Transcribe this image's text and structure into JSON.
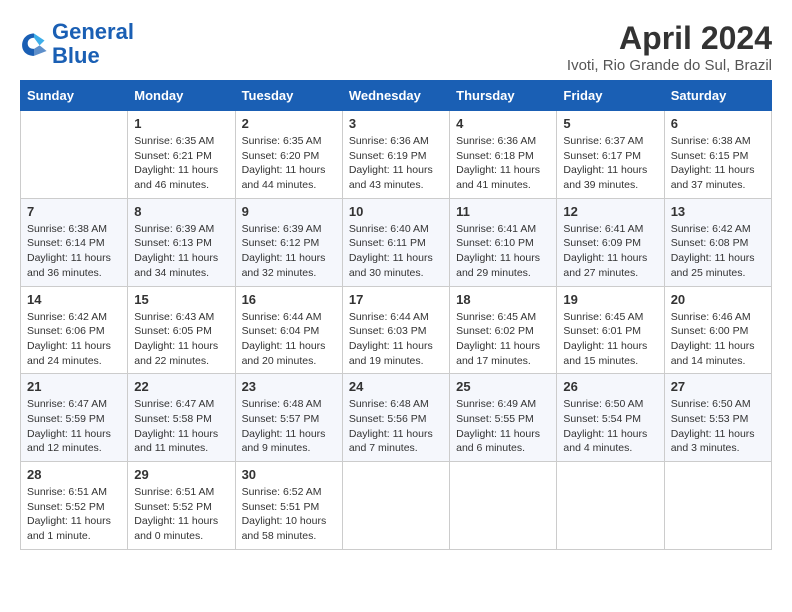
{
  "header": {
    "logo_line1": "General",
    "logo_line2": "Blue",
    "month_title": "April 2024",
    "location": "Ivoti, Rio Grande do Sul, Brazil"
  },
  "days_of_week": [
    "Sunday",
    "Monday",
    "Tuesday",
    "Wednesday",
    "Thursday",
    "Friday",
    "Saturday"
  ],
  "weeks": [
    [
      {
        "day": "",
        "info": ""
      },
      {
        "day": "1",
        "info": "Sunrise: 6:35 AM\nSunset: 6:21 PM\nDaylight: 11 hours\nand 46 minutes."
      },
      {
        "day": "2",
        "info": "Sunrise: 6:35 AM\nSunset: 6:20 PM\nDaylight: 11 hours\nand 44 minutes."
      },
      {
        "day": "3",
        "info": "Sunrise: 6:36 AM\nSunset: 6:19 PM\nDaylight: 11 hours\nand 43 minutes."
      },
      {
        "day": "4",
        "info": "Sunrise: 6:36 AM\nSunset: 6:18 PM\nDaylight: 11 hours\nand 41 minutes."
      },
      {
        "day": "5",
        "info": "Sunrise: 6:37 AM\nSunset: 6:17 PM\nDaylight: 11 hours\nand 39 minutes."
      },
      {
        "day": "6",
        "info": "Sunrise: 6:38 AM\nSunset: 6:15 PM\nDaylight: 11 hours\nand 37 minutes."
      }
    ],
    [
      {
        "day": "7",
        "info": "Sunrise: 6:38 AM\nSunset: 6:14 PM\nDaylight: 11 hours\nand 36 minutes."
      },
      {
        "day": "8",
        "info": "Sunrise: 6:39 AM\nSunset: 6:13 PM\nDaylight: 11 hours\nand 34 minutes."
      },
      {
        "day": "9",
        "info": "Sunrise: 6:39 AM\nSunset: 6:12 PM\nDaylight: 11 hours\nand 32 minutes."
      },
      {
        "day": "10",
        "info": "Sunrise: 6:40 AM\nSunset: 6:11 PM\nDaylight: 11 hours\nand 30 minutes."
      },
      {
        "day": "11",
        "info": "Sunrise: 6:41 AM\nSunset: 6:10 PM\nDaylight: 11 hours\nand 29 minutes."
      },
      {
        "day": "12",
        "info": "Sunrise: 6:41 AM\nSunset: 6:09 PM\nDaylight: 11 hours\nand 27 minutes."
      },
      {
        "day": "13",
        "info": "Sunrise: 6:42 AM\nSunset: 6:08 PM\nDaylight: 11 hours\nand 25 minutes."
      }
    ],
    [
      {
        "day": "14",
        "info": "Sunrise: 6:42 AM\nSunset: 6:06 PM\nDaylight: 11 hours\nand 24 minutes."
      },
      {
        "day": "15",
        "info": "Sunrise: 6:43 AM\nSunset: 6:05 PM\nDaylight: 11 hours\nand 22 minutes."
      },
      {
        "day": "16",
        "info": "Sunrise: 6:44 AM\nSunset: 6:04 PM\nDaylight: 11 hours\nand 20 minutes."
      },
      {
        "day": "17",
        "info": "Sunrise: 6:44 AM\nSunset: 6:03 PM\nDaylight: 11 hours\nand 19 minutes."
      },
      {
        "day": "18",
        "info": "Sunrise: 6:45 AM\nSunset: 6:02 PM\nDaylight: 11 hours\nand 17 minutes."
      },
      {
        "day": "19",
        "info": "Sunrise: 6:45 AM\nSunset: 6:01 PM\nDaylight: 11 hours\nand 15 minutes."
      },
      {
        "day": "20",
        "info": "Sunrise: 6:46 AM\nSunset: 6:00 PM\nDaylight: 11 hours\nand 14 minutes."
      }
    ],
    [
      {
        "day": "21",
        "info": "Sunrise: 6:47 AM\nSunset: 5:59 PM\nDaylight: 11 hours\nand 12 minutes."
      },
      {
        "day": "22",
        "info": "Sunrise: 6:47 AM\nSunset: 5:58 PM\nDaylight: 11 hours\nand 11 minutes."
      },
      {
        "day": "23",
        "info": "Sunrise: 6:48 AM\nSunset: 5:57 PM\nDaylight: 11 hours\nand 9 minutes."
      },
      {
        "day": "24",
        "info": "Sunrise: 6:48 AM\nSunset: 5:56 PM\nDaylight: 11 hours\nand 7 minutes."
      },
      {
        "day": "25",
        "info": "Sunrise: 6:49 AM\nSunset: 5:55 PM\nDaylight: 11 hours\nand 6 minutes."
      },
      {
        "day": "26",
        "info": "Sunrise: 6:50 AM\nSunset: 5:54 PM\nDaylight: 11 hours\nand 4 minutes."
      },
      {
        "day": "27",
        "info": "Sunrise: 6:50 AM\nSunset: 5:53 PM\nDaylight: 11 hours\nand 3 minutes."
      }
    ],
    [
      {
        "day": "28",
        "info": "Sunrise: 6:51 AM\nSunset: 5:52 PM\nDaylight: 11 hours\nand 1 minute."
      },
      {
        "day": "29",
        "info": "Sunrise: 6:51 AM\nSunset: 5:52 PM\nDaylight: 11 hours\nand 0 minutes."
      },
      {
        "day": "30",
        "info": "Sunrise: 6:52 AM\nSunset: 5:51 PM\nDaylight: 10 hours\nand 58 minutes."
      },
      {
        "day": "",
        "info": ""
      },
      {
        "day": "",
        "info": ""
      },
      {
        "day": "",
        "info": ""
      },
      {
        "day": "",
        "info": ""
      }
    ]
  ]
}
